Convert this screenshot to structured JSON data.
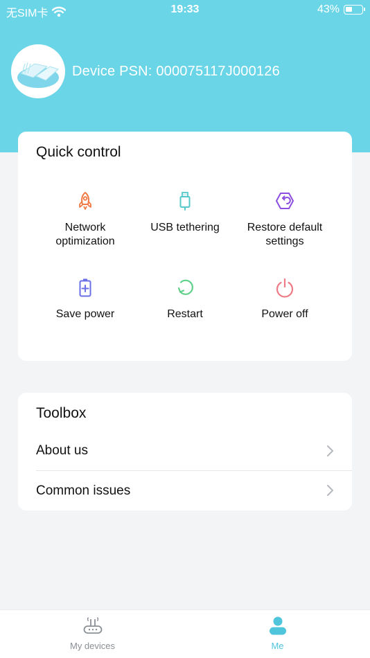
{
  "status_bar": {
    "carrier": "无SIM卡",
    "time": "19:33",
    "battery": "43%",
    "battery_level": 0.43
  },
  "header": {
    "device_psn": "Device PSN: 000075117J000126"
  },
  "quick_control": {
    "title": "Quick control",
    "items": [
      {
        "label": "Network\noptimization",
        "icon": "rocket-icon",
        "color": "#f07a45"
      },
      {
        "label": "USB tethering",
        "icon": "usb-icon",
        "color": "#55c8c9"
      },
      {
        "label": "Restore default\nsettings",
        "icon": "restore-icon",
        "color": "#8b4ee0"
      },
      {
        "label": "Save power",
        "icon": "battery-plus-icon",
        "color": "#6b6fe6"
      },
      {
        "label": "Restart",
        "icon": "restart-icon",
        "color": "#5fd08a"
      },
      {
        "label": "Power off",
        "icon": "power-icon",
        "color": "#ee7a86"
      }
    ]
  },
  "toolbox": {
    "title": "Toolbox",
    "items": [
      {
        "label": "About us"
      },
      {
        "label": "Common issues"
      }
    ]
  },
  "tab_bar": {
    "tabs": [
      {
        "label": "My devices",
        "icon": "router-icon",
        "active": false
      },
      {
        "label": "Me",
        "icon": "person-icon",
        "active": true
      }
    ],
    "active_color": "#4fc5dc",
    "inactive_color": "#8a8f96"
  }
}
